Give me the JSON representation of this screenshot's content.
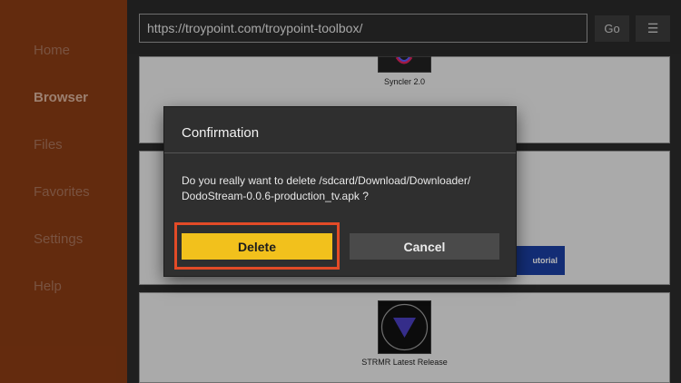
{
  "sidebar": {
    "items": [
      {
        "label": "Home"
      },
      {
        "label": "Browser",
        "active": true
      },
      {
        "label": "Files"
      },
      {
        "label": "Favorites"
      },
      {
        "label": "Settings"
      },
      {
        "label": "Help"
      }
    ]
  },
  "toolbar": {
    "url": "https://troypoint.com/troypoint-toolbox/",
    "go_label": "Go",
    "menu_icon": "☰"
  },
  "page": {
    "apps": [
      {
        "name": "Syncler 2.0"
      },
      {
        "name": "STRMR Latest Release"
      }
    ],
    "tutorial_label": "utorial"
  },
  "dialog": {
    "title": "Confirmation",
    "message_line1": "Do you really want to delete /sdcard/Download/Downloader/",
    "message_line2": "DodoStream-0.0.6-production_tv.apk ?",
    "delete_label": "Delete",
    "cancel_label": "Cancel"
  },
  "colors": {
    "sidebar": "#8a3c14",
    "delete_button": "#f2c11c",
    "highlight": "#e34b27",
    "tutorial_button": "#1b3fa3"
  }
}
